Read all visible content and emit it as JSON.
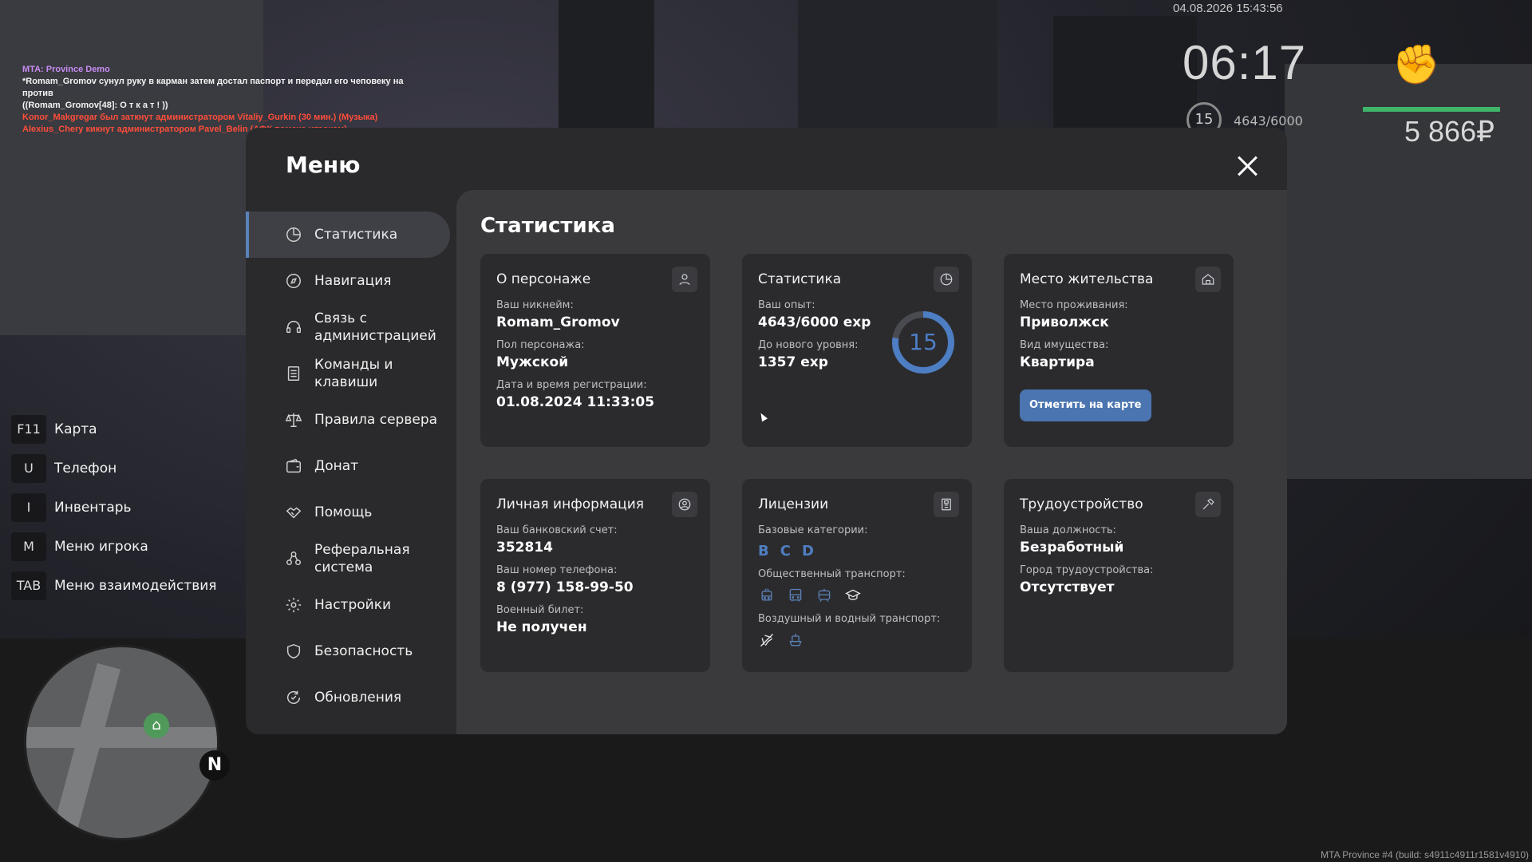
{
  "chat": [
    "MTA: Province Demo",
    "*Romam_Gromov сунул руку в карман затем достал паспорт и передал его чеповеку на против",
    "((Romam_Gromov[48]: О т к а т ! ))",
    "Konor_Makgregar был заткнут администратором Vitaliy_Gurkin (30 мин.) (Музыка)",
    "Alexius_Chery кикнут администратором Pavel_Belin (АФК помеха игрокам)"
  ],
  "hud": {
    "datetime": "04.08.2026 15:43:56",
    "time": "06:17",
    "level": "15",
    "exp": "4643/6000",
    "money": "5 866₽",
    "fist_icon": "fist-icon"
  },
  "hotkeys": [
    {
      "key": "F11",
      "label": "Карта"
    },
    {
      "key": "U",
      "label": "Телефон"
    },
    {
      "key": "I",
      "label": "Инвентарь"
    },
    {
      "key": "M",
      "label": "Меню игрока"
    },
    {
      "key": "TAB",
      "label": "Меню взаимодействия"
    }
  ],
  "minimap": {
    "north": "N"
  },
  "build": "MTA Province #4 (build: s4911c4911r1581v4910)",
  "menu": {
    "title": "Меню",
    "sidebar": [
      {
        "label": "Статистика",
        "icon": "pie-chart-icon",
        "active": true
      },
      {
        "label": "Навигация",
        "icon": "compass-icon"
      },
      {
        "label": "Связь с администрацией",
        "icon": "headset-icon"
      },
      {
        "label": "Команды и клавиши",
        "icon": "list-icon"
      },
      {
        "label": "Правила сервера",
        "icon": "scales-icon"
      },
      {
        "label": "Донат",
        "icon": "wallet-icon"
      },
      {
        "label": "Помощь",
        "icon": "handshake-icon"
      },
      {
        "label": "Реферальная система",
        "icon": "referral-icon"
      },
      {
        "label": "Настройки",
        "icon": "gear-icon"
      },
      {
        "label": "Безопасность",
        "icon": "shield-icon"
      },
      {
        "label": "Обновления",
        "icon": "refresh-icon"
      }
    ],
    "content_title": "Статистика",
    "cards": {
      "character": {
        "title": "О персонаже",
        "nick_label": "Ваш никнейм:",
        "nick": "Romam_Gromov",
        "gender_label": "Пол персонажа:",
        "gender": "Мужской",
        "reg_label": "Дата и время регистрации:",
        "reg": "01.08.2024 11:33:05"
      },
      "stats": {
        "title": "Статистика",
        "exp_label": "Ваш опыт:",
        "exp": "4643/6000 exp",
        "next_label": "До нового уровня:",
        "next": "1357 exp",
        "level": "15",
        "progress": 0.774
      },
      "residence": {
        "title": "Место жительства",
        "place_label": "Место проживания:",
        "place": "Приволжск",
        "prop_label": "Вид имущества:",
        "prop": "Квартира",
        "button": "Отметить на карте"
      },
      "personal": {
        "title": "Личная информация",
        "bank_label": "Ваш банковский счет:",
        "bank": "352814",
        "phone_label": "Ваш номер телефона:",
        "phone": "8 (977) 158-99-50",
        "mil_label": "Военный билет:",
        "mil": "Не получен"
      },
      "licenses": {
        "title": "Лицензии",
        "base_label": "Базовые категории:",
        "base": [
          "B",
          "C",
          "D"
        ],
        "public_label": "Общественный транспорт:",
        "public_icons": [
          "trolleybus-icon",
          "bus-icon",
          "tram-icon",
          "graduation-icon"
        ],
        "air_label": "Воздушный и водный транспорт:",
        "air_icons": [
          "plane-icon",
          "boat-icon"
        ]
      },
      "job": {
        "title": "Трудоустройство",
        "pos_label": "Ваша должность:",
        "pos": "Безработный",
        "city_label": "Город трудоустройства:",
        "city": "Отсутствует"
      }
    }
  }
}
